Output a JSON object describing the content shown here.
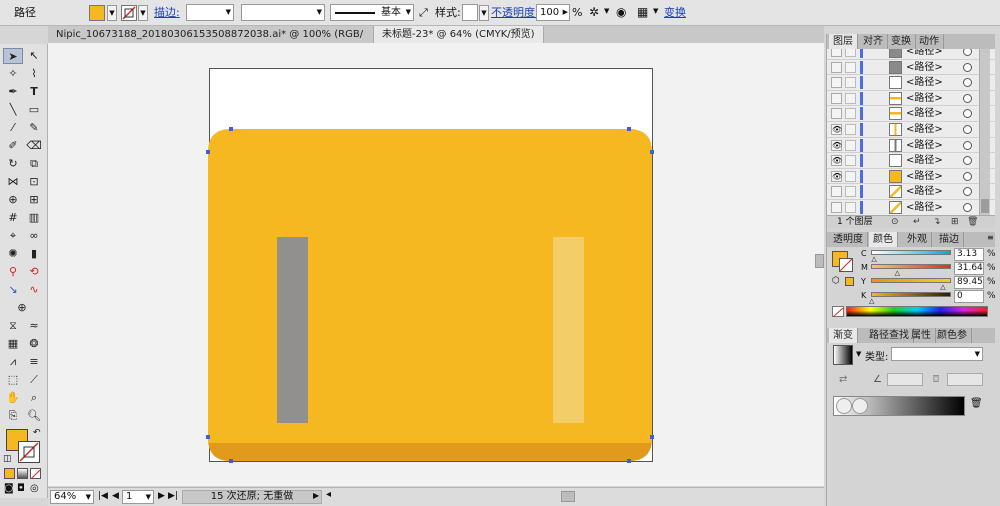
{
  "control_bar": {
    "selection_label": "路径",
    "fill_color": "#f5b821",
    "stroke_label": "描边:",
    "stroke_weight": "",
    "stroke_profile_label": "基本",
    "style_label": "样式:",
    "opacity_label": "不透明度:",
    "opacity_value": "100",
    "opacity_unit": "%",
    "transform_label": "变换"
  },
  "doc_tabs": [
    {
      "label": "Nipic_10673188_20180306153508872038.ai* @ 100% (RGB/预览)",
      "active": false
    },
    {
      "label": "未标题-23* @ 64% (CMYK/预览)",
      "active": true
    }
  ],
  "artwork": {
    "card_color": "#f5b821",
    "card_bottom_color": "#e29a1c",
    "left_bar_color": "#928f8f",
    "right_bar_color": "#f3cd67"
  },
  "status_bar": {
    "zoom": "64%",
    "page": "1",
    "history_text": "15 次还原; 无重做"
  },
  "layers_panel": {
    "tabs": [
      "图层",
      "对齐",
      "变换",
      "动作"
    ],
    "rows": [
      {
        "name": "<路径>",
        "visible": false,
        "thumb": "gray"
      },
      {
        "name": "<路径>",
        "visible": false,
        "thumb": "gray"
      },
      {
        "name": "<路径>",
        "visible": false,
        "thumb": "white"
      },
      {
        "name": "<路径>",
        "visible": false,
        "thumb": "stripe-h"
      },
      {
        "name": "<路径>",
        "visible": false,
        "thumb": "stripe-h"
      },
      {
        "name": "<路径>",
        "visible": true,
        "thumb": "stripe-v"
      },
      {
        "name": "<路径>",
        "visible": true,
        "thumb": "bar-v"
      },
      {
        "name": "<路径>",
        "visible": true,
        "thumb": "white"
      },
      {
        "name": "<路径>",
        "visible": true,
        "thumb": "orange"
      },
      {
        "name": "<路径>",
        "visible": false,
        "thumb": "diag"
      },
      {
        "name": "<路径>",
        "visible": false,
        "thumb": "diag"
      }
    ],
    "footer_label": "1 个图层"
  },
  "color_panel": {
    "tabs": [
      "透明度",
      "颜色",
      "外观",
      "描边"
    ],
    "active_tab": "颜色",
    "channels": [
      {
        "label": "C",
        "value": "3.13",
        "unit": "%",
        "level": 0.03
      },
      {
        "label": "M",
        "value": "31.64",
        "unit": "%",
        "level": 0.32
      },
      {
        "label": "Y",
        "value": "89.45",
        "unit": "%",
        "level": 0.89
      },
      {
        "label": "K",
        "value": "0",
        "unit": "%",
        "level": 0.0
      }
    ]
  },
  "gradient_panel": {
    "tabs": [
      "渐变",
      "路径查找",
      "属性",
      "颜色参"
    ],
    "type_label": "类型:"
  }
}
